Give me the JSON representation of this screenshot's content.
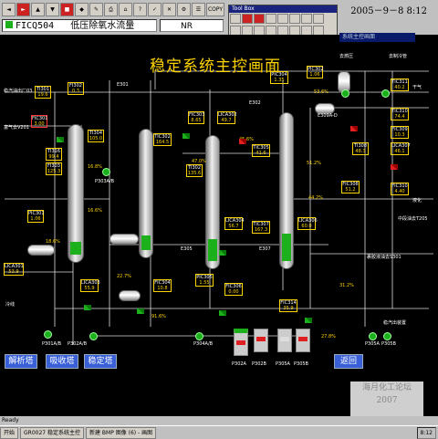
{
  "window": {
    "tag": "FICQ504",
    "tag_desc": "低压除氧水流量",
    "nr": "NR",
    "datetime": "2005－9－8  8:12",
    "tools_title": "Tool Box",
    "panel_strip": "系统主控画面"
  },
  "toolbar": {
    "row1": [
      "◄",
      "►",
      "▲",
      "▼",
      "■",
      "◆",
      "✎",
      "⎙",
      "⌂",
      "?",
      "✓",
      "✕",
      "⚙",
      "☰",
      "▣"
    ],
    "copy": "COPY"
  },
  "screen": {
    "title": "稳定系统主控画面",
    "left_labels": {
      "feed": "稳汽油出厂03",
      "gas": "富气去V201",
      "exit": "冷线"
    },
    "right_labels": {
      "to_recycle": "去燃压",
      "to_mfg": "去制冷管",
      "gas_out": "干气",
      "liquid": "液化",
      "lpg_out": "中段油去T205",
      "dry_out": "裹胶液油去S301",
      "stab_out": "稳汽出装置"
    },
    "section_labels": [
      "E301",
      "E302",
      "E305",
      "E307",
      "E309A-D",
      "E301A/B"
    ],
    "pumps": [
      "P301A/B",
      "P302A/B",
      "P303A/B",
      "P304A/B",
      "P305A",
      "P305B"
    ],
    "bottom_pumps": [
      "P302A",
      "P302B",
      "P305A",
      "P305B"
    ],
    "instruments": [
      {
        "tag": "TI301",
        "val": "19.6"
      },
      {
        "tag": "FI302",
        "val": "0.3"
      },
      {
        "tag": "TI316",
        "val": "99.4"
      },
      {
        "tag": "FI303",
        "val": "125.3"
      },
      {
        "tag": "TI304",
        "val": "105.0"
      },
      {
        "tag": "FIC301",
        "val": "3.00"
      },
      {
        "tag": "PIC301",
        "val": "1.06"
      },
      {
        "tag": "LICA301",
        "val": "53.9"
      },
      {
        "tag": "TIC302",
        "val": "164.5"
      },
      {
        "tag": "FIC303",
        "val": "8.65"
      },
      {
        "tag": "LICA302",
        "val": "49.7"
      },
      {
        "tag": "TI302",
        "val": "135.6"
      },
      {
        "tag": "PIC304",
        "val": "1.35"
      },
      {
        "tag": "FIC304",
        "val": "10.8"
      },
      {
        "tag": "TIC305",
        "val": "41.6"
      },
      {
        "tag": "LICA304",
        "val": "56.7"
      },
      {
        "tag": "FIC306",
        "val": "0.00"
      },
      {
        "tag": "TIC307",
        "val": "167.3"
      },
      {
        "tag": "LICA306",
        "val": "60.0"
      },
      {
        "tag": "FIC308",
        "val": "51.2"
      },
      {
        "tag": "PIC302",
        "val": "1.06"
      },
      {
        "tag": "TI308",
        "val": "48.3"
      },
      {
        "tag": "FIC309",
        "val": "10.3"
      },
      {
        "tag": "LICA307",
        "val": "46.1"
      },
      {
        "tag": "FIC310",
        "val": "4.40"
      },
      {
        "tag": "TIC310",
        "val": "74.4"
      },
      {
        "tag": "TIC311",
        "val": "40.2"
      },
      {
        "tag": "LICA303",
        "val": "55.9"
      },
      {
        "tag": "PIC305",
        "val": "1.55"
      },
      {
        "tag": "FIC314",
        "val": "35.9"
      }
    ],
    "small_vals": [
      "16.8%",
      "47.0%",
      "53.6%",
      "45.6%",
      "16.6%",
      "18.6%",
      "51.2%",
      "91.6%",
      "44.2%",
      "22.7%",
      "27.8%",
      "31.2%"
    ]
  },
  "nav": {
    "btn1": "解析塔",
    "btn2": "吸收塔",
    "btn3": "稳定塔",
    "btn4": "返回"
  },
  "status": {
    "text": "Ready"
  },
  "taskbar": {
    "start": "开始",
    "tasks": [
      "GR0027 稳定系统主控",
      "新建 BMP 图像 (6) - 画图"
    ],
    "clock": "8:12"
  },
  "watermark": {
    "line1": "海月化工论坛",
    "line2": "2007"
  }
}
